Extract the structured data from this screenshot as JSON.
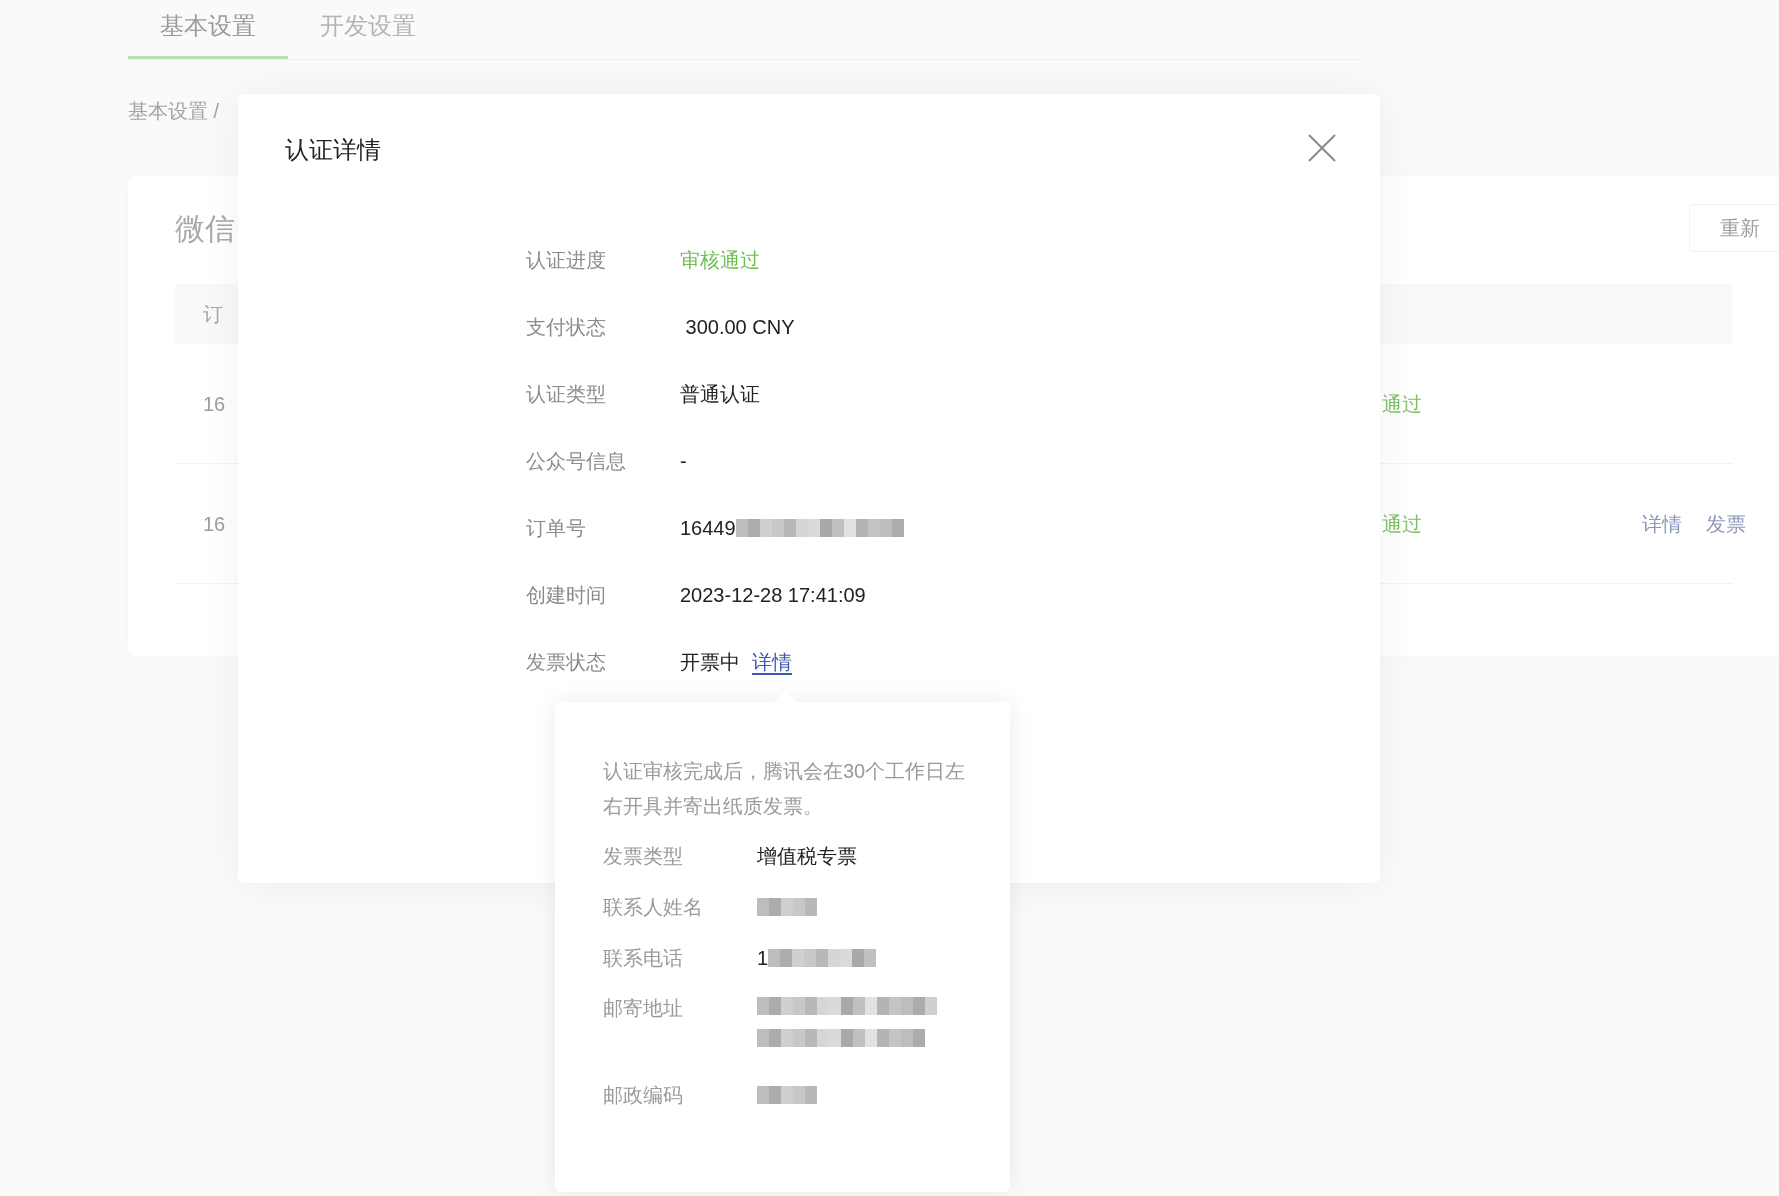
{
  "tabs": [
    {
      "label": "基本设置",
      "selected": true
    },
    {
      "label": "开发设置",
      "selected": false
    }
  ],
  "breadcrumb": "基本设置 /",
  "card": {
    "title": "微信",
    "button": "重新",
    "table": {
      "header": "订",
      "rows": [
        {
          "id": "16",
          "status": "通过",
          "actions": []
        },
        {
          "id": "16",
          "status": "通过",
          "actions": [
            "详情",
            "发票"
          ]
        }
      ]
    }
  },
  "dialog": {
    "title": "认证详情",
    "fields": [
      {
        "kind": "status",
        "label": "认证进度",
        "value": "审核通过"
      },
      {
        "kind": "text",
        "label": "支付状态",
        "value": " 300.00 CNY"
      },
      {
        "kind": "text",
        "label": "认证类型",
        "value": "普通认证"
      },
      {
        "kind": "text",
        "label": "公众号信息",
        "value": "-"
      },
      {
        "kind": "redacted",
        "label": "订单号",
        "value": "16449"
      },
      {
        "kind": "text",
        "label": "创建时间",
        "value": "2023-12-28 17:41:09"
      },
      {
        "kind": "link",
        "label": "发票状态",
        "value": "开票中",
        "link": "详情"
      }
    ]
  },
  "popover": {
    "note": "认证审核完成后，腾讯会在30个工作日左右开具并寄出纸质发票。",
    "fields": [
      {
        "kind": "text",
        "label": "发票类型",
        "value": "增值税专票"
      },
      {
        "kind": "redacted",
        "label": "联系人姓名"
      },
      {
        "kind": "redacted",
        "label": "联系电话",
        "value": "1"
      },
      {
        "kind": "address",
        "label": "邮寄地址"
      },
      {
        "kind": "redacted",
        "label": "邮政编码"
      }
    ]
  }
}
